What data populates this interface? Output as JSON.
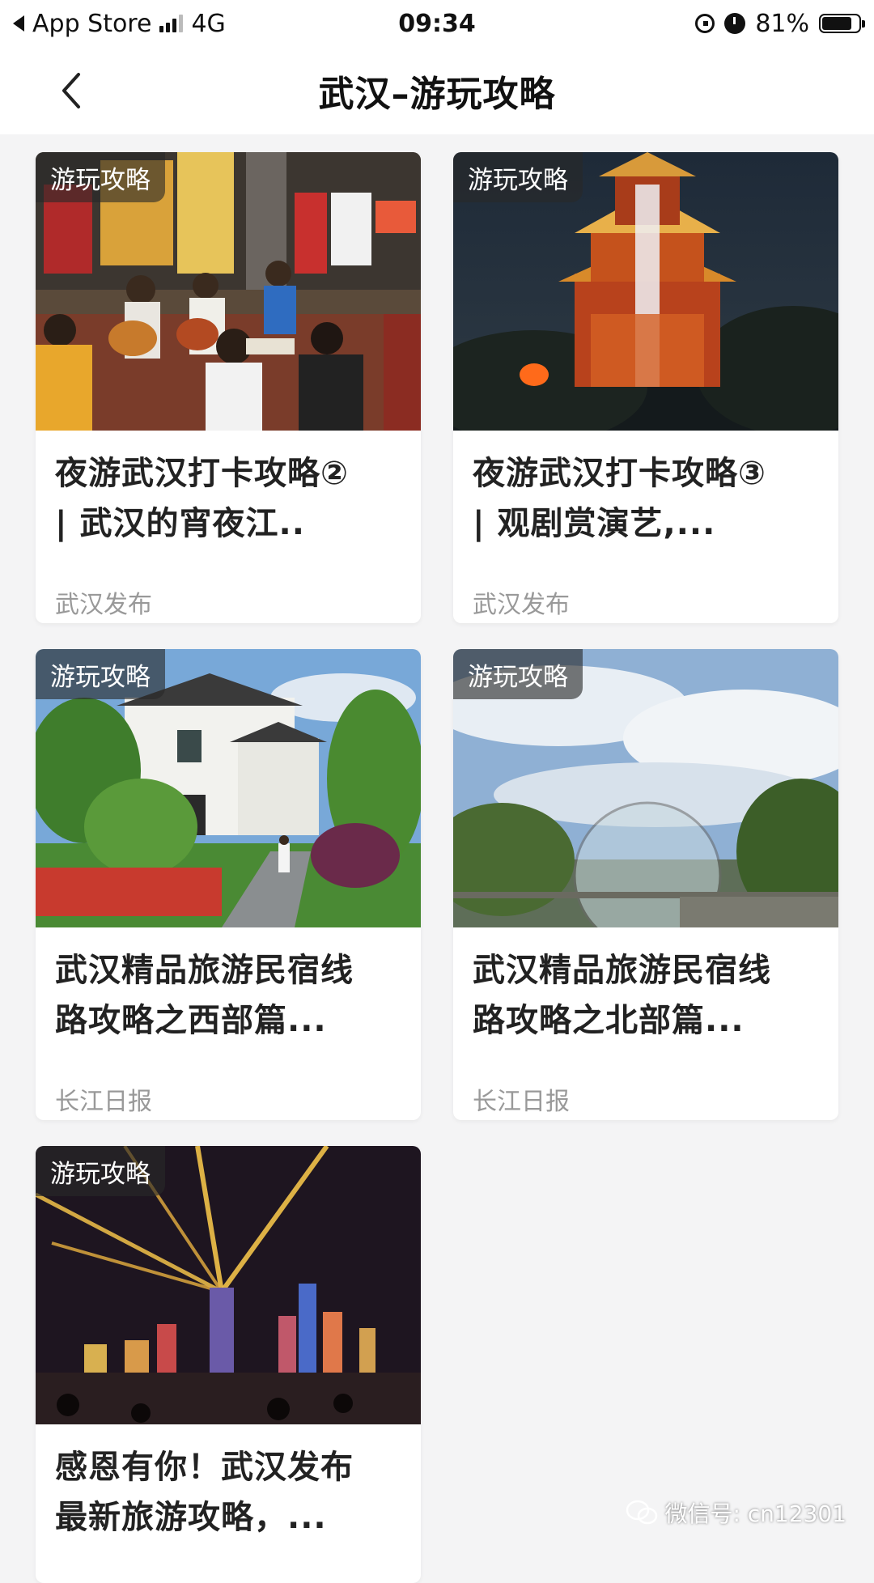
{
  "status_bar": {
    "back_app": "App Store",
    "network": "4G",
    "time": "09:34",
    "battery_percent_text": "81%",
    "battery_level": 0.81
  },
  "nav": {
    "title": "武汉–游玩攻略",
    "back_icon": "chevron-left-icon"
  },
  "cards": [
    {
      "tag": "游玩攻略",
      "title_line1": "夜游武汉打卡攻略②",
      "title_line2": "| 武汉的宵夜江..",
      "source": "武汉发布"
    },
    {
      "tag": "游玩攻略",
      "title_line1": "夜游武汉打卡攻略③",
      "title_line2": "| 观剧赏演艺,...",
      "source": "武汉发布"
    },
    {
      "tag": "游玩攻略",
      "title_line1": "武汉精品旅游民宿线",
      "title_line2": "路攻略之西部篇...",
      "source": "长江日报"
    },
    {
      "tag": "游玩攻略",
      "title_line1": "武汉精品旅游民宿线",
      "title_line2": "路攻略之北部篇...",
      "source": "长江日报"
    },
    {
      "tag": "游玩攻略",
      "title_line1": "感恩有你！武汉发布",
      "title_line2": "最新旅游攻略，...",
      "source": ""
    }
  ],
  "watermark": {
    "text": "微信号: cn12301",
    "icon": "wechat-icon"
  }
}
